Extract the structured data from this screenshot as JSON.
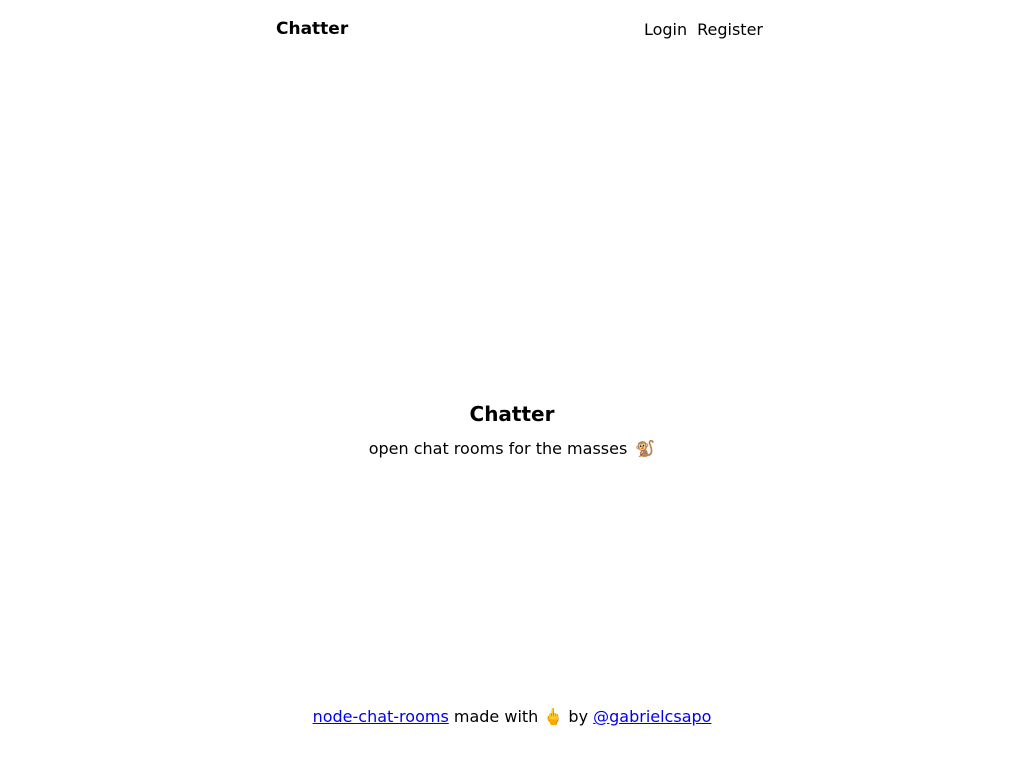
{
  "header": {
    "brand": "Chatter",
    "nav": {
      "login": "Login",
      "register": "Register"
    }
  },
  "hero": {
    "title": "Chatter",
    "tagline": "open chat rooms for the masses",
    "tagline_emoji": "🐒"
  },
  "footer": {
    "repo_link": "node-chat-rooms",
    "made_with": "made with",
    "emoji": "🖕",
    "by": "by",
    "author_link": "@gabrielcsapo"
  },
  "colors": {
    "link": "#0000ee",
    "text": "#000000",
    "background": "#ffffff"
  }
}
